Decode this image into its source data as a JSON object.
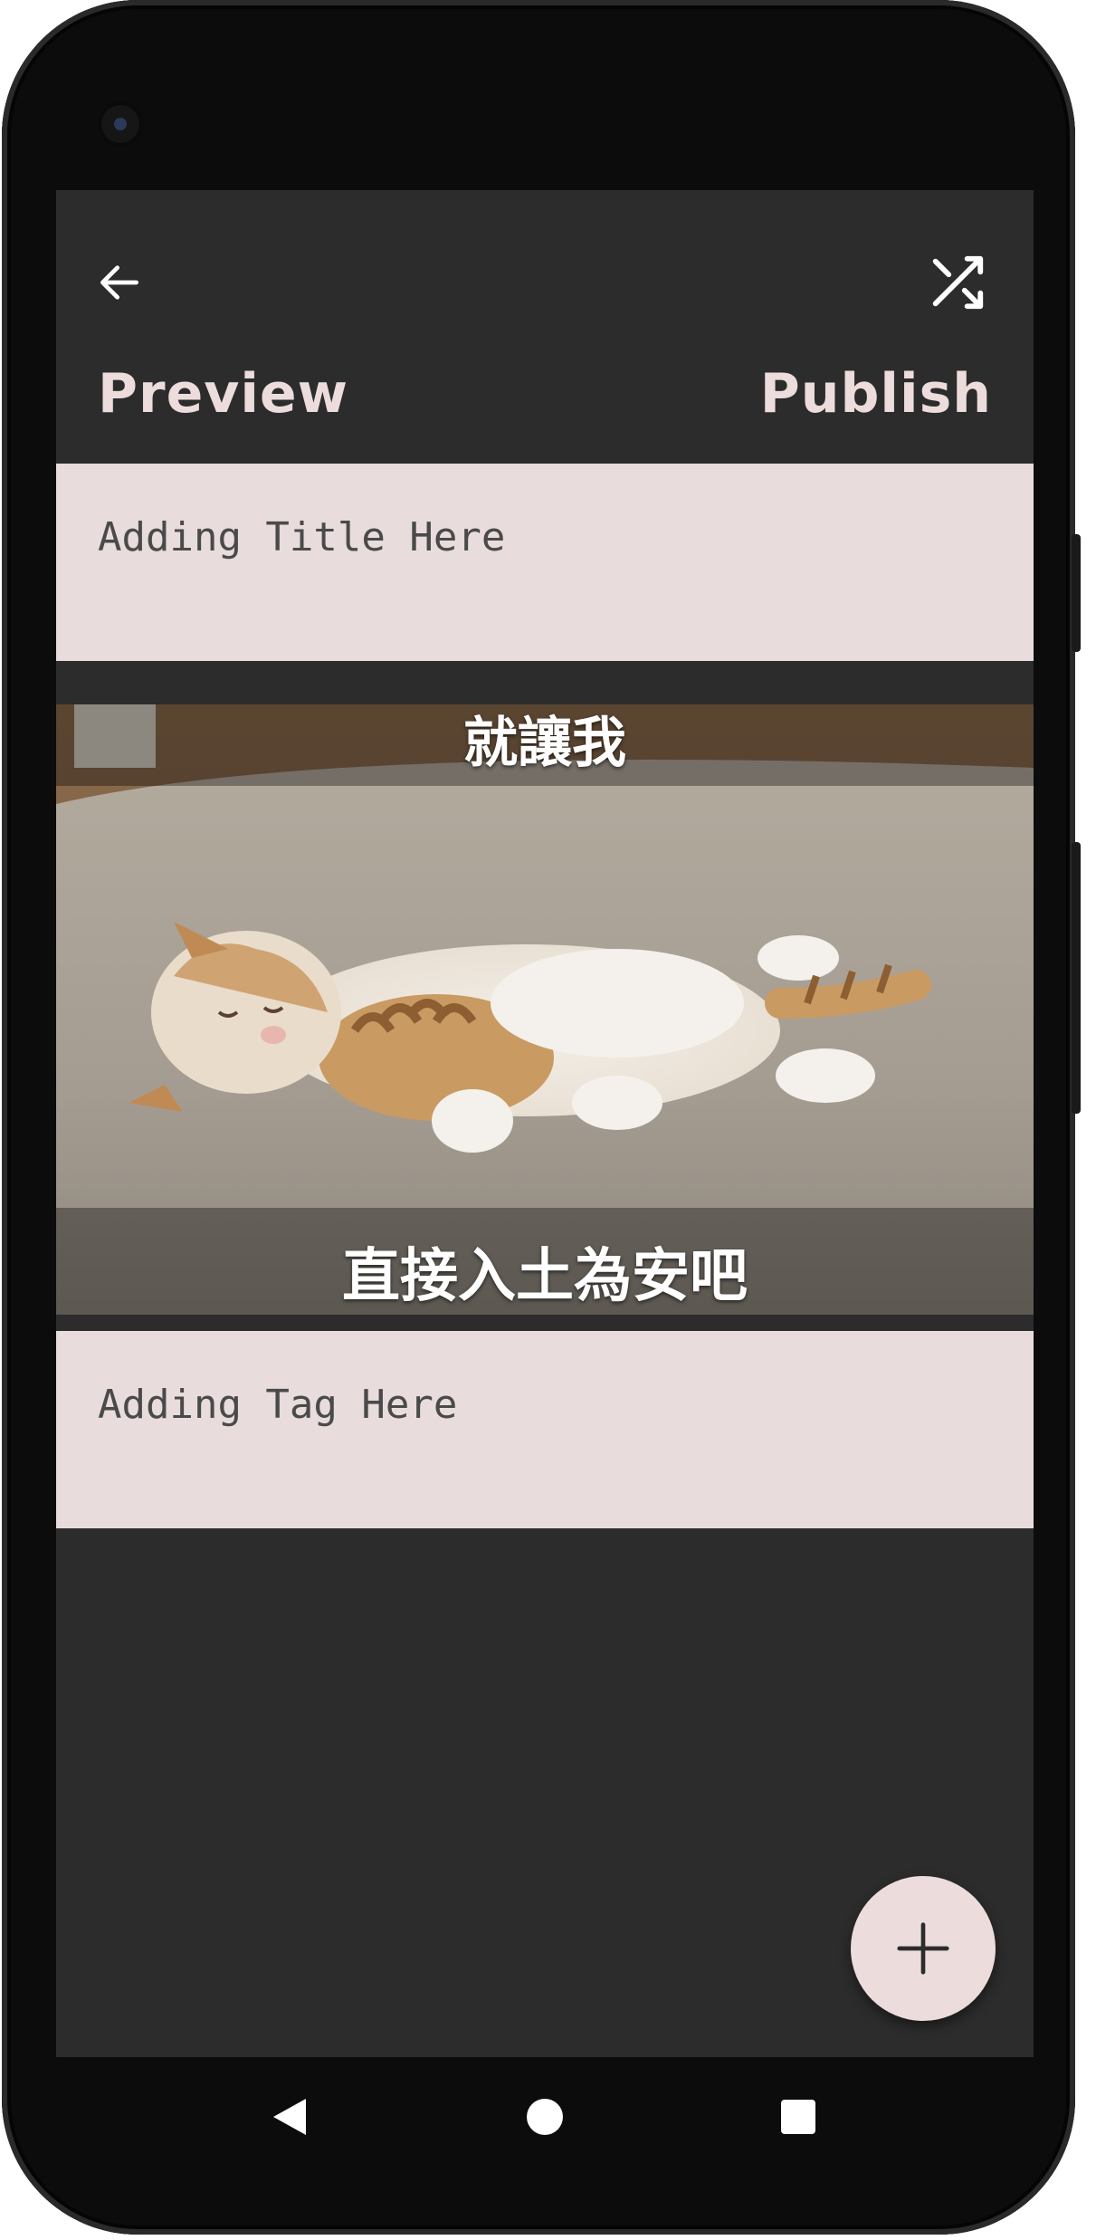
{
  "header": {
    "back_icon": "arrow-left-icon",
    "shuffle_icon": "shuffle-icon",
    "preview_label": "Preview",
    "publish_label": "Publish"
  },
  "title_field": {
    "placeholder": "Adding Title Here"
  },
  "meme": {
    "image": "sleeping-kitten-photo",
    "top_caption": "就讓我",
    "bottom_caption": "直接入土為安吧"
  },
  "tag_field": {
    "placeholder": "Adding Tag Here"
  },
  "fab": {
    "icon": "plus-icon"
  },
  "nav": {
    "back": "nav-back-icon",
    "home": "nav-home-icon",
    "recents": "nav-recents-icon"
  },
  "colors": {
    "screen_bg": "#2c2c2c",
    "field_bg": "#e8dcdc",
    "accent_text": "#ecdcdc"
  }
}
